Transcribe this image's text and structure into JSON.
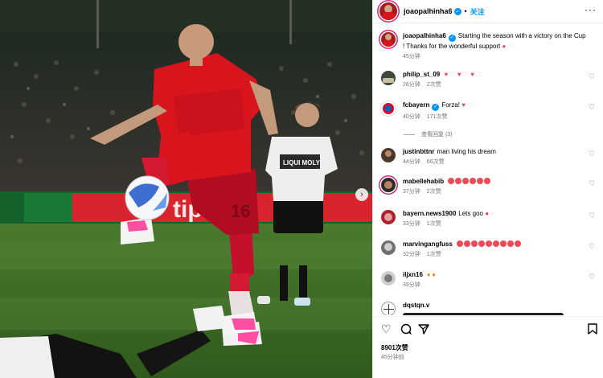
{
  "post": {
    "username": "joaopalhinha6",
    "follow_label": "关注",
    "separator": "•",
    "more_label": "···",
    "next_label": "›"
  },
  "caption": {
    "username": "joaopalhinha6",
    "text": "Starting the season with a victory on the Cup ! Thanks for the wonderful support",
    "time": "45分钟"
  },
  "comments": [
    {
      "username": "philip_st_09",
      "text": "",
      "time": "26分钟",
      "likes": "2次赞",
      "reply": ""
    },
    {
      "username": "fcbayern",
      "text": "Forza!",
      "time": "40分钟",
      "likes": "171次赞",
      "reply": ""
    },
    {
      "username": "justinbttnr",
      "text": "man living his dream",
      "time": "44分钟",
      "likes": "66次赞",
      "reply": ""
    },
    {
      "username": "mabellehabib",
      "text": "",
      "time": "37分钟",
      "likes": "2次赞",
      "reply": ""
    },
    {
      "username": "bayern.news1900",
      "text": "Lets goo",
      "time": "33分钟",
      "likes": "1次赞",
      "reply": ""
    },
    {
      "username": "marvingangfuss",
      "text": "",
      "time": "32分钟",
      "likes": "1次赞",
      "reply": ""
    },
    {
      "username": "iljxn16",
      "text": "",
      "time": "39分钟",
      "likes": "",
      "reply": ""
    },
    {
      "username": "dqstqn.v",
      "text": "",
      "time": "",
      "likes": "",
      "reply": ""
    }
  ],
  "view_replies": "查看回复 (3)",
  "actions": {
    "likes": "8901次赞",
    "time": "45分钟前"
  },
  "photo": {
    "jersey_number": "16",
    "board_text": "tipico",
    "opponent_sponsor": "LIQUI MOLY"
  },
  "colors": {
    "accent": "#0095f6",
    "heart": "#ed4956",
    "story_ring": "#d62976",
    "bayern_red": "#d8141c"
  },
  "icons": [
    "like-icon",
    "comment-icon",
    "share-icon",
    "save-icon",
    "more-icon",
    "verified-icon",
    "heart-icon",
    "next-icon"
  ]
}
